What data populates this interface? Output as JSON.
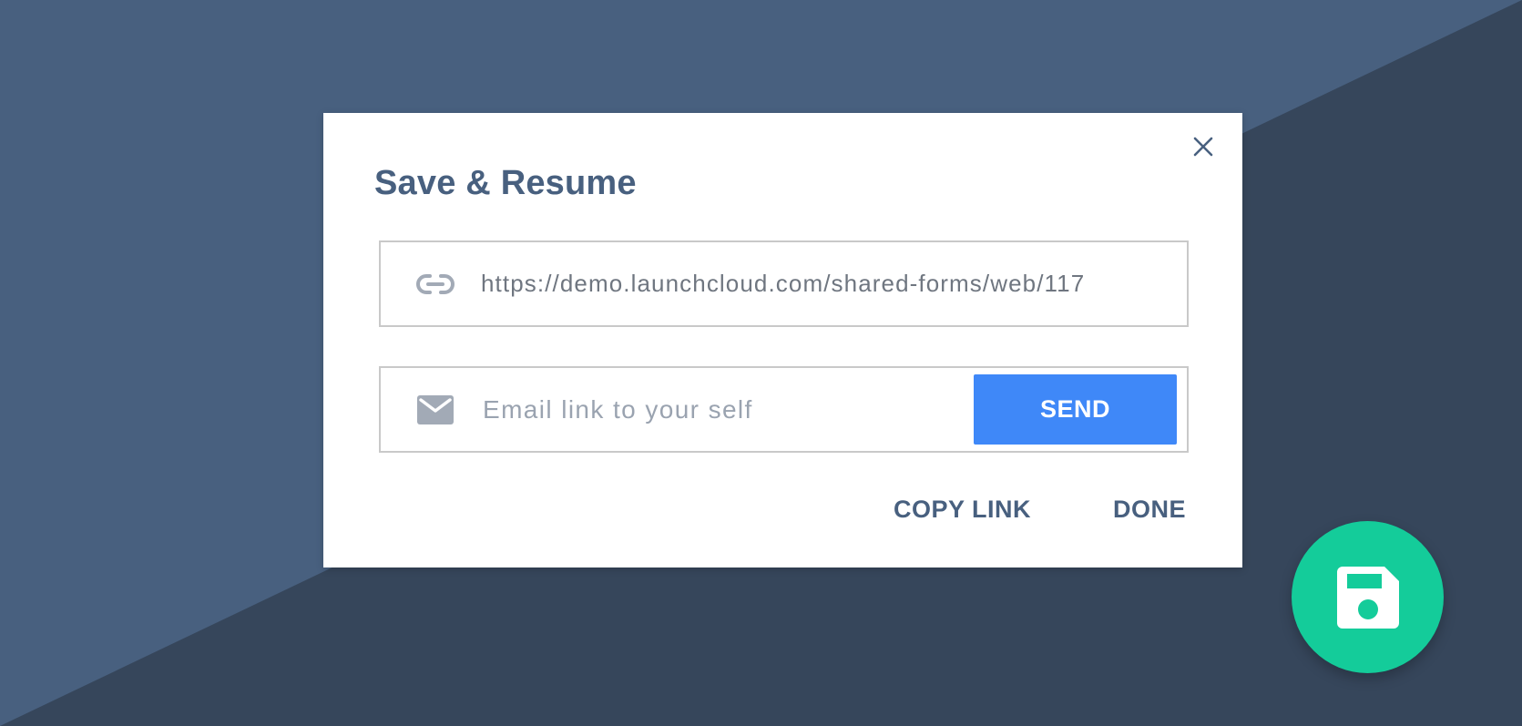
{
  "dialog": {
    "title": "Save & Resume",
    "close_icon": "close-icon",
    "link_field": {
      "icon": "link-icon",
      "value": "https://demo.launchcloud.com/shared-forms/web/117"
    },
    "email_field": {
      "icon": "envelope-icon",
      "placeholder": "Email link to your self",
      "value": ""
    },
    "send_label": "SEND",
    "copy_link_label": "COPY LINK",
    "done_label": "DONE"
  },
  "fab": {
    "icon": "floppy-disk-save-icon"
  },
  "colors": {
    "background_light": "#48607f",
    "background_dark": "#36465b",
    "title_text": "#48607f",
    "send_button": "#3f88f8",
    "fab": "#14cc9a"
  }
}
